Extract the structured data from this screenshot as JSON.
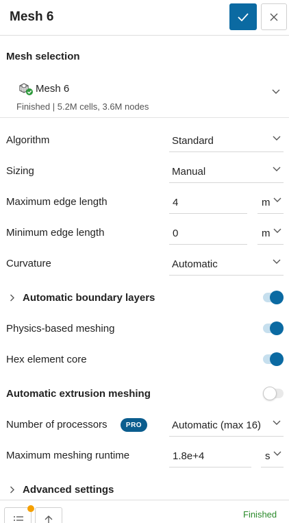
{
  "header": {
    "title": "Mesh 6",
    "confirm_icon": "check-icon",
    "close_icon": "close-icon"
  },
  "mesh_selection": {
    "section_title": "Mesh selection",
    "name": "Mesh 6",
    "status_line": "Finished | 5.2M cells, 3.6M nodes",
    "icon": "mesh-finished-icon"
  },
  "settings": {
    "algorithm": {
      "label": "Algorithm",
      "value": "Standard"
    },
    "sizing": {
      "label": "Sizing",
      "value": "Manual"
    },
    "max_edge": {
      "label": "Maximum edge length",
      "value": "4",
      "unit": "m"
    },
    "min_edge": {
      "label": "Minimum edge length",
      "value": "0",
      "unit": "m"
    },
    "curvature": {
      "label": "Curvature",
      "value": "Automatic"
    },
    "boundary_layers": {
      "label": "Automatic boundary layers",
      "enabled": true
    },
    "physics_based": {
      "label": "Physics-based meshing",
      "enabled": true
    },
    "hex_core": {
      "label": "Hex element core",
      "enabled": true
    },
    "extrusion": {
      "label": "Automatic extrusion meshing",
      "enabled": false
    },
    "processors": {
      "label": "Number of processors",
      "badge": "PRO",
      "value": "Automatic (max 16)"
    },
    "runtime": {
      "label": "Maximum meshing runtime",
      "value": "1.8e+4",
      "unit": "s"
    },
    "advanced": {
      "label": "Advanced settings"
    }
  },
  "footer": {
    "status": "Finished",
    "list_icon": "list-icon",
    "up_icon": "arrow-up-icon"
  },
  "colors": {
    "accent": "#0b6aa2",
    "status_ok": "#2a8a2a",
    "notification": "#f5a000"
  }
}
